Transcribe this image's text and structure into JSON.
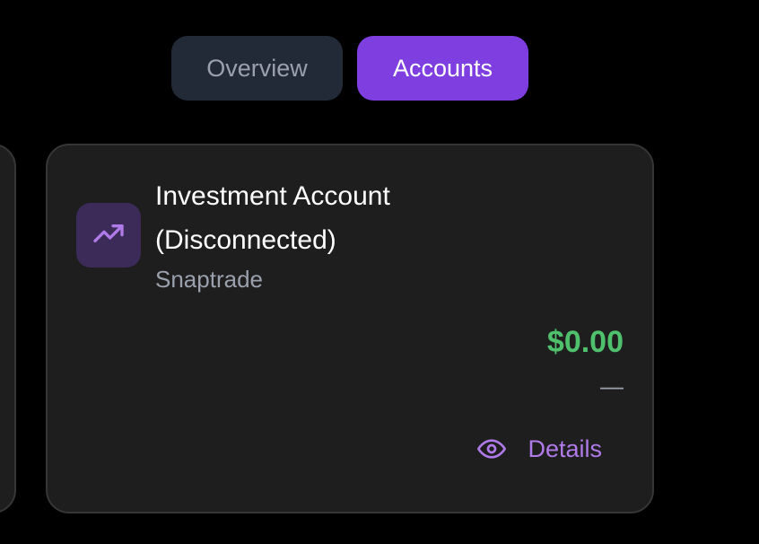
{
  "tabs": [
    {
      "label": "Overview",
      "active": false
    },
    {
      "label": "Accounts",
      "active": true
    }
  ],
  "account_card": {
    "title": "Investment Account (Disconnected)",
    "provider": "Snaptrade",
    "balance": "$0.00",
    "change": "—",
    "details_label": "Details",
    "icon": "trending-up-icon"
  },
  "colors": {
    "background": "#000000",
    "card": "#1e1e1f",
    "accent": "#7e3ee0",
    "balance": "#4fc16d",
    "link": "#b07be8"
  }
}
